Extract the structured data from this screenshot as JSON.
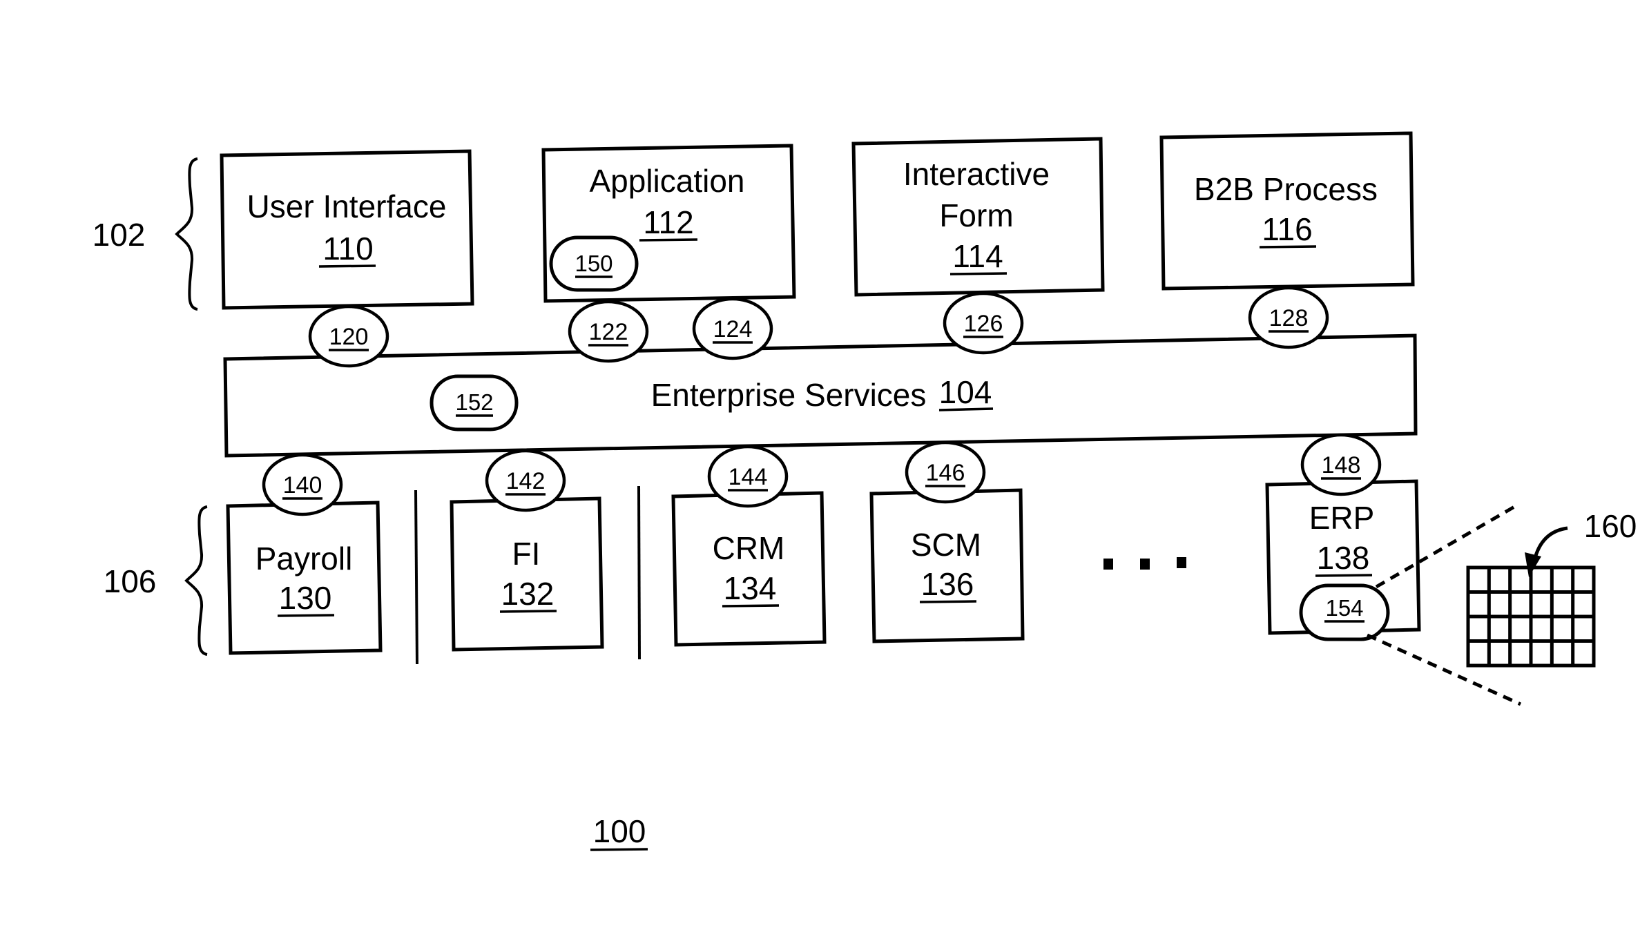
{
  "figure": {
    "reference": "100",
    "layers": {
      "top": {
        "ref": "102"
      },
      "bottom": {
        "ref": "106"
      }
    },
    "top_components": [
      {
        "id": "ui",
        "name": "User Interface",
        "ref": "110",
        "connector": "120"
      },
      {
        "id": "app",
        "name": "Application",
        "ref": "112",
        "inner": "150",
        "connectors": [
          "122",
          "124"
        ]
      },
      {
        "id": "form",
        "name_line1": "Interactive",
        "name_line2": "Form",
        "ref": "114",
        "connector": "126"
      },
      {
        "id": "b2b",
        "name": "B2B Process",
        "ref": "116",
        "connector": "128"
      }
    ],
    "enterprise_services": {
      "name": "Enterprise Services",
      "ref": "104",
      "inner": "152"
    },
    "bottom_components": [
      {
        "id": "payroll",
        "name": "Payroll",
        "ref": "130",
        "connector": "140"
      },
      {
        "id": "fi",
        "name": "FI",
        "ref": "132",
        "connector": "142"
      },
      {
        "id": "crm",
        "name": "CRM",
        "ref": "134",
        "connector": "144"
      },
      {
        "id": "scm",
        "name": "SCM",
        "ref": "136",
        "connector": "146"
      },
      {
        "id": "erp",
        "name": "ERP",
        "ref": "138",
        "connector": "148",
        "inner": "154"
      }
    ],
    "ellipsis": "...",
    "detail_view": {
      "ref": "160",
      "grid_rows": 4,
      "grid_cols": 6
    }
  }
}
